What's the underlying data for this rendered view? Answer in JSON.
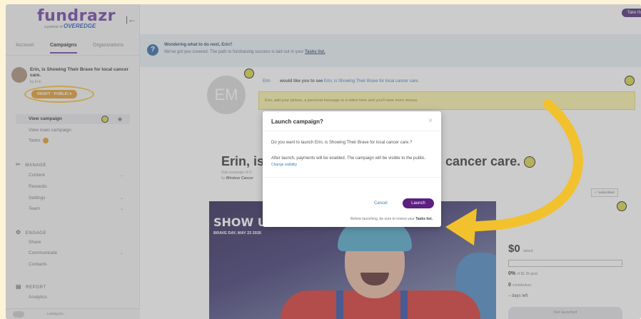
{
  "logo": {
    "word": "fundrazr",
    "partner": "a partner of",
    "partner_brand": "OVEREDGE"
  },
  "account_tabs": [
    "Account",
    "Campaigns",
    "Organizations"
  ],
  "campaign_card": {
    "title": "Erin, is Showing Their Brave for local cancer care.",
    "by": "by Erin",
    "status": "DRAFT · PUBLIC ▾"
  },
  "nav": {
    "view_campaign": "View campaign",
    "view_main_campaign": "View main campaign",
    "tasks": "Tasks",
    "manage": "MANAGE",
    "content": "Content",
    "rewards": "Rewards",
    "settings": "Settings",
    "team": "Team",
    "engage": "ENGAGE",
    "share": "Share",
    "communicate": "Communicate",
    "contacts": "Contacts",
    "report": "REPORT",
    "analytics": "Analytics"
  },
  "footer": {
    "text": "Looking for..."
  },
  "take_tour": "Take th",
  "tip": {
    "title": "Wondering what to do next, Erin?",
    "body": "We've got you covered. The path to fundraising success is laid out in your",
    "link": "Tasks list."
  },
  "avatar_initials": "EM",
  "invite": {
    "name": "Erin",
    "middle": "would like you to see",
    "campaign": "Erin, is Showing Their Brave for local cancer care."
  },
  "yellow_note": "Erin, add your picture, a personal message or a video here and you'll raise more money.",
  "heading": {
    "left": "Erin, is S",
    "right": "cancer care."
  },
  "sub_campaign": {
    "line1": "Sub-campaign of S",
    "line2": "by",
    "org": "Windsor Cancer"
  },
  "subscribed": "✓ Subscribed",
  "hero": {
    "title": "SHOW US",
    "date": "BRAVE DAY, MAY 23 2026"
  },
  "funds": {
    "raised": "$0",
    "raised_label": "raised",
    "percent": "0%",
    "percent_label": "of $1.0k goal",
    "contributors": "0",
    "contributors_label": "contributors",
    "days": "– days left",
    "not_launched": "Not launched"
  },
  "modal": {
    "title": "Launch campaign?",
    "close": "×",
    "question": "Do you want to launch Erin, is Showing Their Brave for local cancer care.?",
    "after": "After launch, payments will be enabled. The campaign will be visible to the public.",
    "change_visibility": "Change visibility",
    "cancel": "Cancel",
    "launch": "Launch",
    "footer": "Before launching, be sure to review your",
    "footer_link": "Tasks list."
  },
  "colors": {
    "brand_purple": "#5b2080",
    "annotation_yellow": "#f2c12e",
    "status_orange": "#e39a2b"
  },
  "icons": [
    "collapse-sidebar-icon",
    "pencil-icon",
    "eye-icon",
    "manage-icon",
    "engage-icon",
    "report-icon",
    "info-icon",
    "close-icon"
  ]
}
